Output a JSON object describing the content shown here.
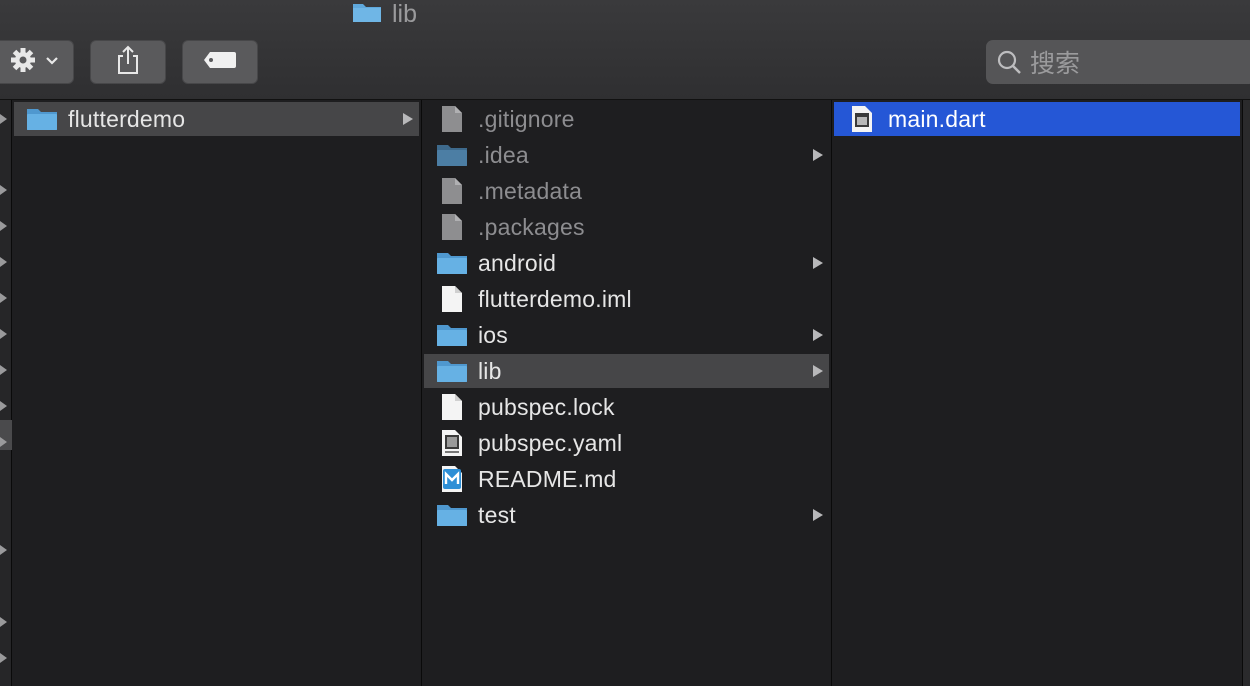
{
  "window": {
    "title": "lib"
  },
  "toolbar": {
    "search_placeholder": "搜索",
    "action_icon": "gear-icon",
    "share_icon": "share-icon",
    "tag_icon": "tag-icon"
  },
  "colors": {
    "selection_blue": "#2557d6",
    "folder_blue": "#5fa8dc",
    "selection_gray": "#464648"
  },
  "columns": [
    {
      "items": [
        {
          "name": "flutterdemo",
          "kind": "folder",
          "has_children": true,
          "selected": "gray"
        }
      ]
    },
    {
      "items": [
        {
          "name": ".gitignore",
          "kind": "file-gray",
          "hidden": true
        },
        {
          "name": ".idea",
          "kind": "folder",
          "hidden": true,
          "has_children": true
        },
        {
          "name": ".metadata",
          "kind": "file-gray",
          "hidden": true
        },
        {
          "name": ".packages",
          "kind": "file-gray",
          "hidden": true
        },
        {
          "name": "android",
          "kind": "folder",
          "has_children": true
        },
        {
          "name": "flutterdemo.iml",
          "kind": "file"
        },
        {
          "name": "ios",
          "kind": "folder",
          "has_children": true
        },
        {
          "name": "lib",
          "kind": "folder",
          "has_children": true,
          "selected": "gray"
        },
        {
          "name": "pubspec.lock",
          "kind": "file"
        },
        {
          "name": "pubspec.yaml",
          "kind": "file-yaml"
        },
        {
          "name": "README.md",
          "kind": "file-md"
        },
        {
          "name": "test",
          "kind": "folder",
          "has_children": true
        }
      ]
    },
    {
      "items": [
        {
          "name": "main.dart",
          "kind": "file-code",
          "selected": "blue"
        }
      ]
    }
  ]
}
